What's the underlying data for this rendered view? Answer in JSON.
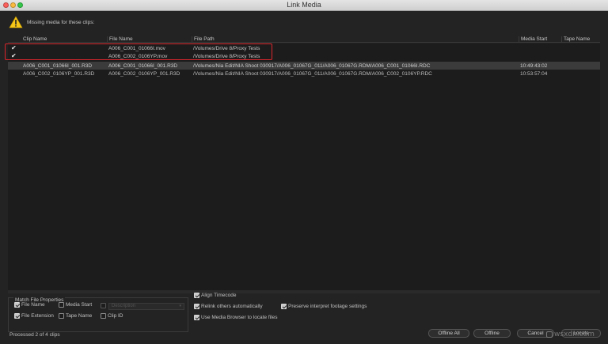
{
  "window": {
    "title": "Link Media"
  },
  "message": "Missing media for these clips:",
  "columns": {
    "clip_name": "Clip Name",
    "file_name": "File Name",
    "file_path": "File Path",
    "media_start": "Media Start",
    "tape_name": "Tape Name"
  },
  "rows": [
    {
      "checked": true,
      "clip_name": "",
      "file_name": "A006_C001_01066I.mov",
      "file_path": "/Volumes/Drive 8/Proxy Tests",
      "media_start": "",
      "tape_name": ""
    },
    {
      "checked": true,
      "clip_name": "",
      "file_name": "A006_C002_0106YP.mov",
      "file_path": "/Volumes/Drive 8/Proxy Tests",
      "media_start": "",
      "tape_name": ""
    },
    {
      "checked": false,
      "clip_name": "A006_C001_01066I_001.R3D",
      "file_name": "A006_C001_01066I_001.R3D",
      "file_path": "/Volumes/Nia Edit/NIA Shoot 030917/A006_01067G_011/A006_01067G.RDM/A006_C001_01066I.RDC",
      "media_start": "10:49:43:02",
      "tape_name": ""
    },
    {
      "checked": false,
      "clip_name": "A006_C002_0106YP_001.R3D",
      "file_name": "A006_C002_0106YP_001.R3D",
      "file_path": "/Volumes/Nia Edit/NIA Shoot 030917/A006_01067G_011/A006_01067G.RDM/A006_C002_0106YP.RDC",
      "media_start": "10:53:57:04",
      "tape_name": ""
    }
  ],
  "match": {
    "title": "Match File Properties",
    "file_name": "File Name",
    "media_start": "Media Start",
    "description": "Description",
    "file_extension": "File Extension",
    "tape_name": "Tape Name",
    "clip_id": "Clip ID"
  },
  "options": {
    "align_timecode": "Align Timecode",
    "relink_others": "Relink others automatically",
    "preserve_interpret": "Preserve interpret footage settings",
    "use_media_browser": "Use Media Browser to locate files"
  },
  "status": "Processed 2 of 4 clips",
  "buttons": {
    "offline_all": "Offline All",
    "offline": "Offline",
    "cancel": "Cancel",
    "locate": "Locate"
  },
  "watermark": "wsxdn.com",
  "colors": {
    "highlight_border": "#d9252b",
    "warning": "#f5c518"
  },
  "icons": {
    "warning": "warning-triangle-icon",
    "check": "checkmark-icon"
  }
}
